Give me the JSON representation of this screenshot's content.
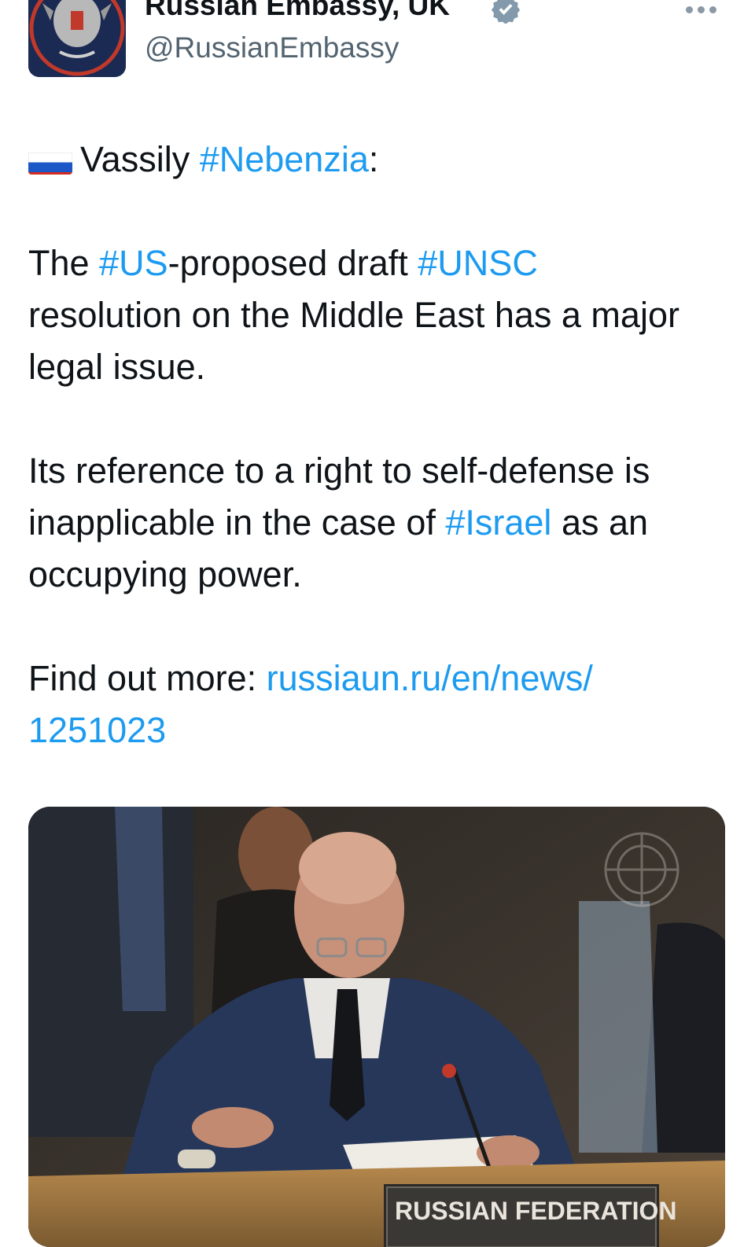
{
  "header": {
    "display_name": "Russian Embassy, UK",
    "handle": "@RussianEmbassy",
    "verified_icon": "verified-badge-icon",
    "more_icon": "more-options-icon"
  },
  "tweet": {
    "flag_icon": "russia-flag-icon",
    "line1_prefix": "Vassily ",
    "line1_tag": "#Nebenzia",
    "line1_suffix": ":",
    "p2_a": "The ",
    "p2_tag1": "#US",
    "p2_b": "-proposed draft ",
    "p2_tag2": "#UNSC",
    "p2_c": "resolution on the Middle East has a major legal issue.",
    "p3_a": "Its reference to a right to self-defense is inapplicable in the case of ",
    "p3_tag": "#Israel",
    "p3_b": " as an occupying power.",
    "p4_label": "Find out more: ",
    "p4_link_line1": "russiaun.ru/en/news/",
    "p4_link_line2": "1251023"
  },
  "media": {
    "nameplate": "RUSSIAN FEDERATION"
  },
  "colors": {
    "link": "#1d9bf0",
    "text": "#0f1419",
    "secondary": "#536471"
  }
}
